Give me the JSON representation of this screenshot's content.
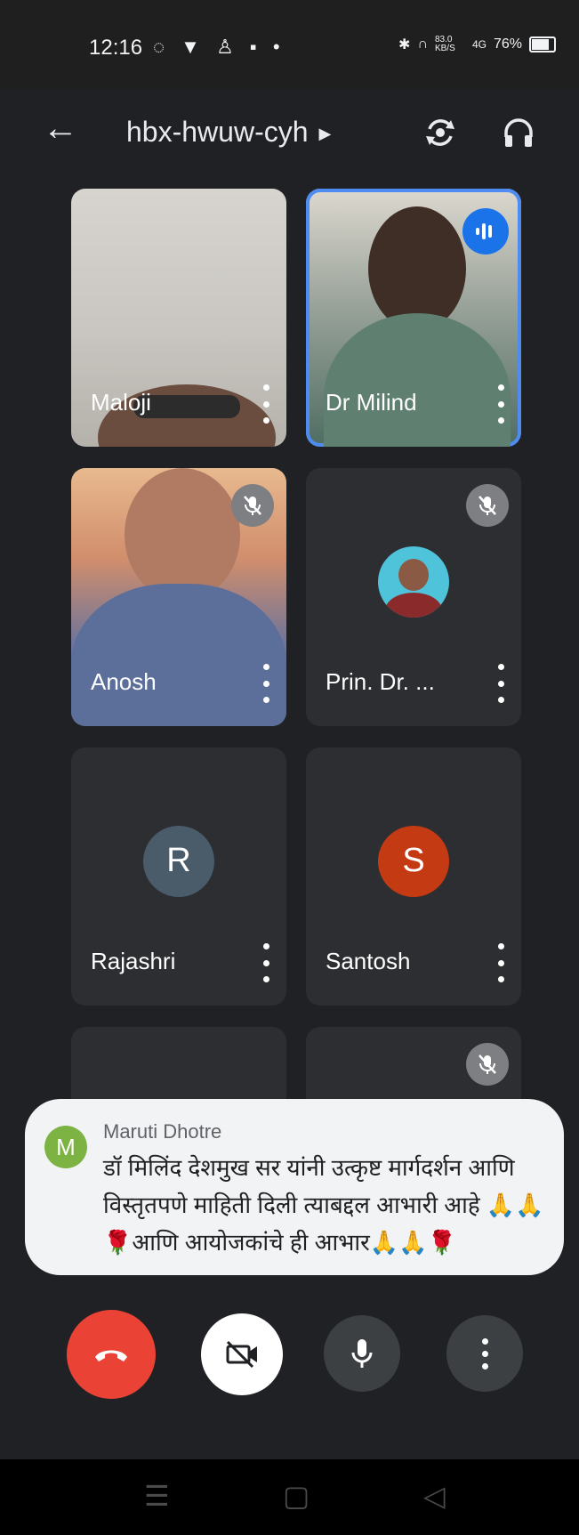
{
  "status_bar": {
    "time": "12:16",
    "battery": "76%",
    "net_speed": "83.0 KB/S",
    "signal": "4G"
  },
  "app_bar": {
    "meeting_code": "hbx-hwuw-cyh"
  },
  "tiles": [
    {
      "name": "Maloji"
    },
    {
      "name": "Dr Milind"
    },
    {
      "name": "Anosh"
    },
    {
      "name": "Prin. Dr. ..."
    },
    {
      "name": "Rajashri",
      "initial": "R",
      "color": "#4a5b6a"
    },
    {
      "name": "Santosh",
      "initial": "S",
      "color": "#c43a12"
    }
  ],
  "notification": {
    "avatar_initial": "M",
    "sender": "Maruti Dhotre",
    "message": "डॉ मिलिंद देशमुख सर यांनी उत्कृष्ट मार्गदर्शन आणि विस्तृतपणे माहिती दिली त्याबद्दल आभारी आहे 🙏🙏 🌹आणि आयोजकांचे ही आभार🙏🙏🌹"
  },
  "colors": {
    "end_call": "#ea4335",
    "active_speaker_outline": "#4f8cf1",
    "background": "#202124"
  }
}
